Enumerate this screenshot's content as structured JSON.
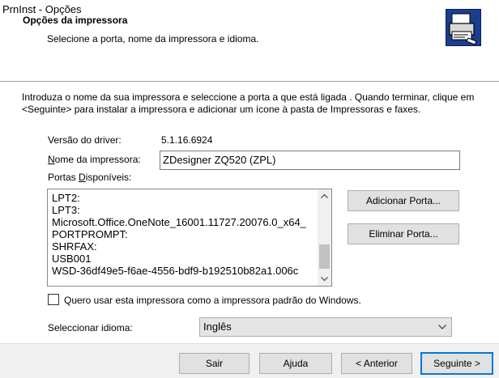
{
  "window": {
    "title": "PrnInst - Opções"
  },
  "header": {
    "title": "Opções da impressora",
    "subtitle": "Selecione a porta, nome da impressora e idioma.",
    "icon": "printer-install-icon"
  },
  "intro": "Introduza o nome da sua impressora e seleccione a porta a que está ligada . Quando terminar, clique em <Seguinte> para instalar a impressora e adicionar um ícone à pasta de Impressoras e faxes.",
  "driver": {
    "label": "Versão do driver:",
    "value": "5.1.16.6924"
  },
  "printer_name": {
    "label_underlined": "N",
    "label_rest": "ome da impressora:",
    "value": "ZDesigner ZQ520 (ZPL)"
  },
  "ports": {
    "label_pre": "Portas ",
    "label_underlined": "D",
    "label_rest": "isponíveis:",
    "items": [
      "LPT2:",
      "LPT3:",
      "Microsoft.Office.OneNote_16001.11727.20076.0_x64_",
      "PORTPROMPT:",
      "SHRFAX:",
      "USB001",
      "WSD-36df49e5-f6ae-4556-bdf9-b192510b82a1.006c"
    ],
    "add_button": "Adicionar Porta...",
    "remove_button": "Eliminar Porta..."
  },
  "default_printer": {
    "label": "Quero usar esta impressora como a impressora padrão do Windows.",
    "checked": false
  },
  "language": {
    "label": "Seleccionar idioma:",
    "selected": "Inglês"
  },
  "footer": {
    "exit": "Sair",
    "help": "Ajuda",
    "back": "< Anterior",
    "next": "Seguinte >"
  },
  "colors": {
    "accent_border": "#0078d7",
    "footer_bg": "#f0f0f0",
    "button_bg": "#e1e1e1"
  }
}
